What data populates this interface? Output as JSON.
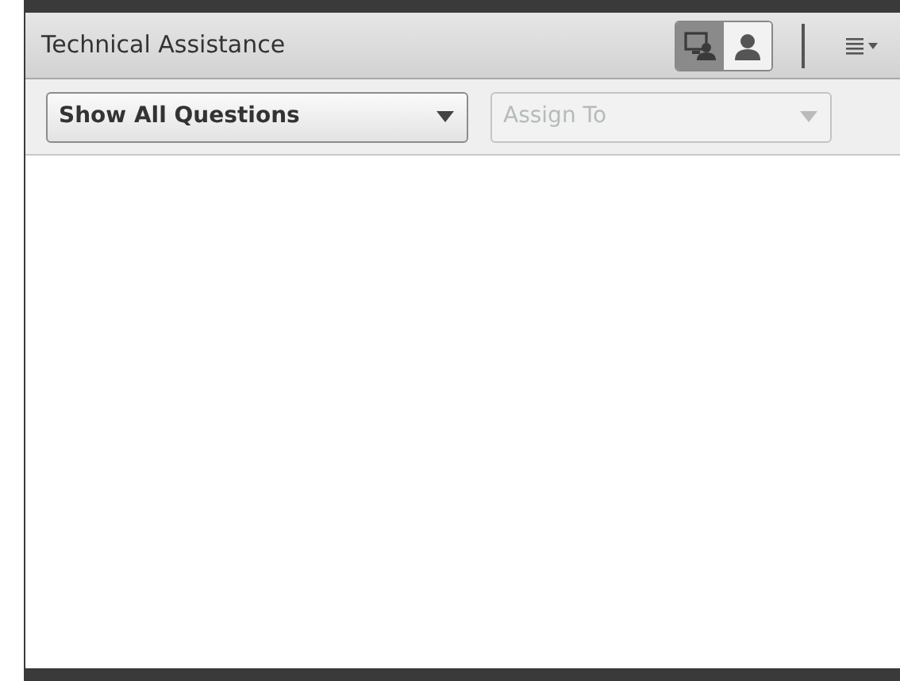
{
  "panel": {
    "title": "Technical Assistance"
  },
  "view_toggles": [
    {
      "kind": "screen",
      "selected": true
    },
    {
      "kind": "person",
      "selected": false
    }
  ],
  "filters": [
    {
      "value": "Show All Questions",
      "disabled": false
    },
    {
      "value": "Assign To",
      "disabled": true
    }
  ]
}
